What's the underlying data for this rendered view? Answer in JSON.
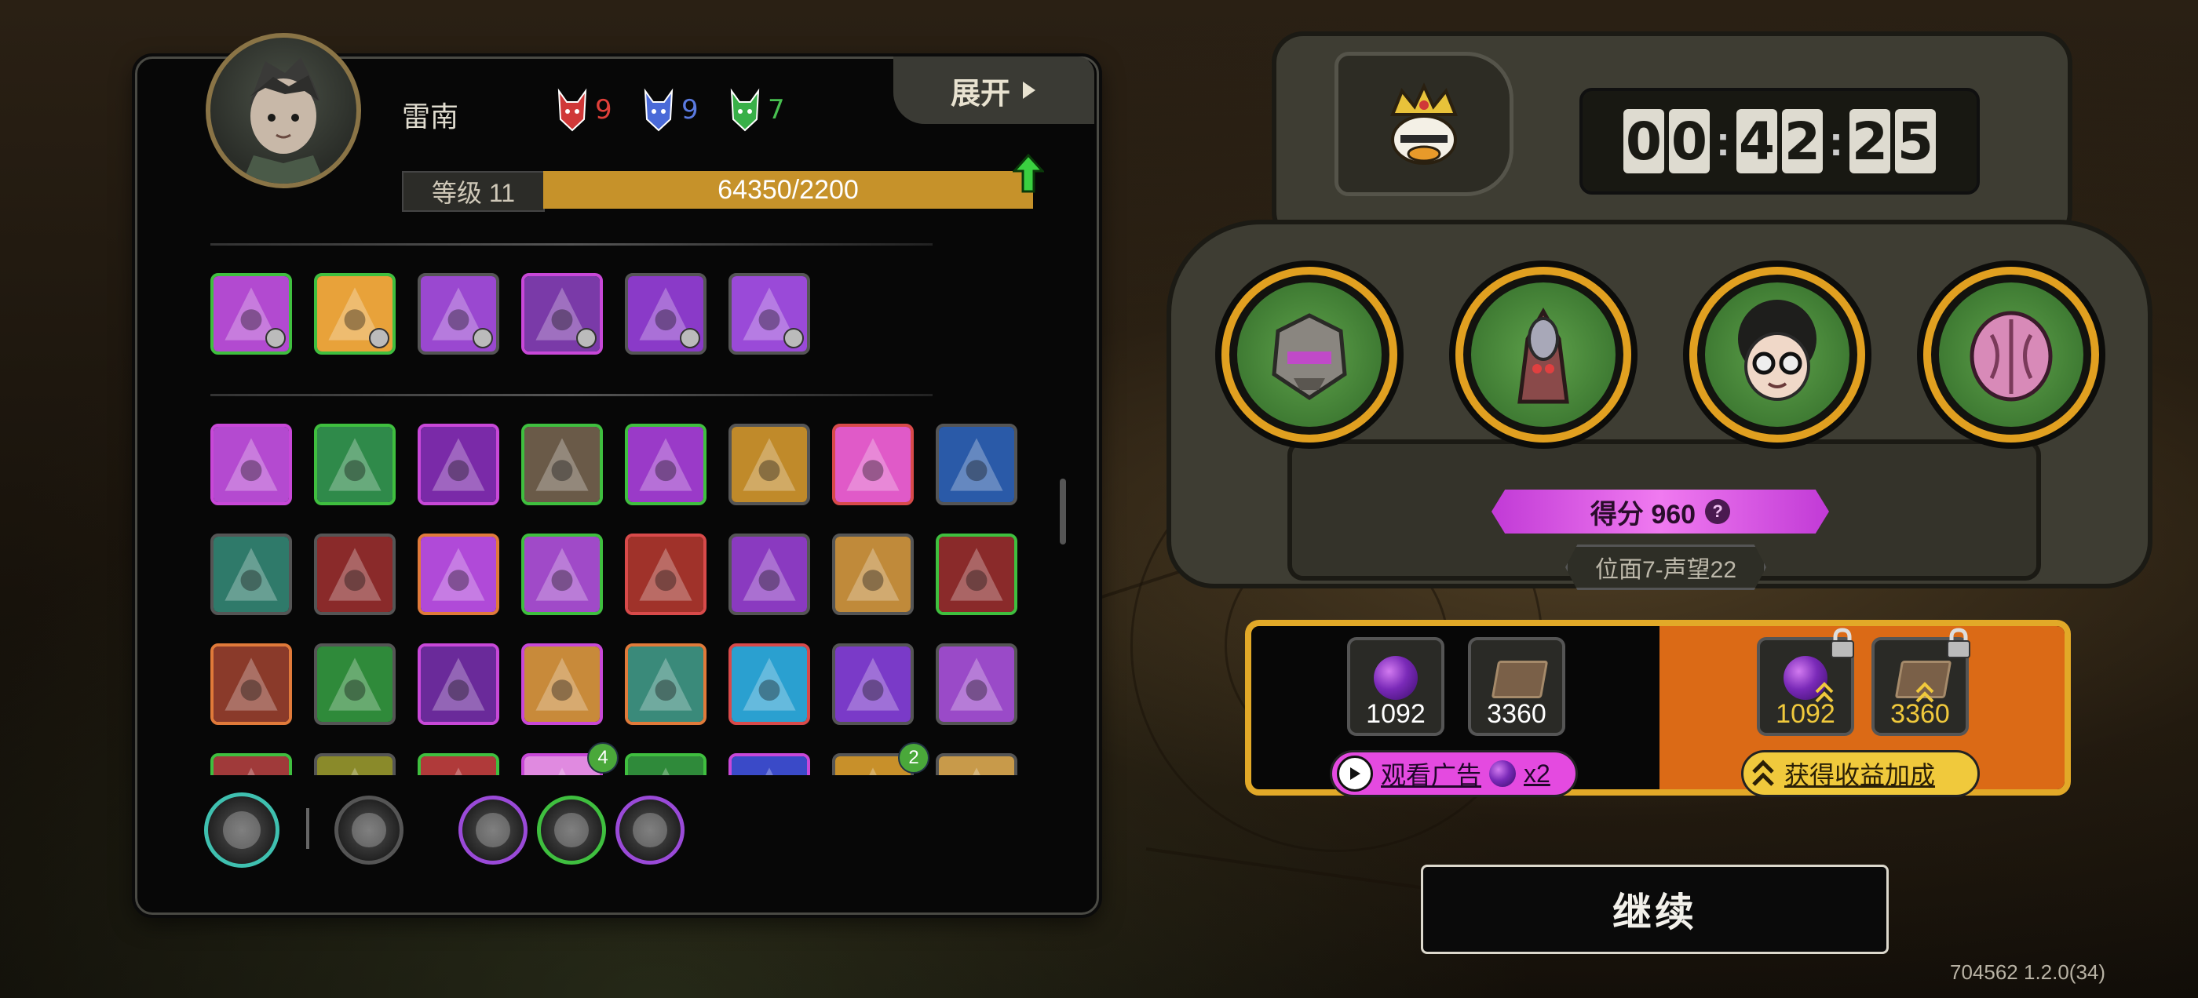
{
  "player": {
    "name": "雷南",
    "level_label": "等级 11",
    "xp_text": "64350/2200",
    "expand_label": "展开"
  },
  "costs": [
    {
      "icon": "red-horned-mask-icon",
      "value": "9",
      "color": "#e0403a"
    },
    {
      "icon": "blue-horned-mask-icon",
      "value": "9",
      "color": "#5a7ae0"
    },
    {
      "icon": "green-horned-mask-icon",
      "value": "7",
      "color": "#48c050"
    }
  ],
  "equip_slots": [
    {
      "name": "equip-slot-1",
      "icon": "pink-boot-icon",
      "frame": "#3fbf3f",
      "fill": "#b24ad0"
    },
    {
      "name": "equip-slot-2",
      "icon": "orange-belt-icon",
      "frame": "#3fbf3f",
      "fill": "#e8a23a"
    },
    {
      "name": "equip-slot-3",
      "icon": "purple-gauntlet-icon",
      "frame": "#555555",
      "fill": "#9a48d0"
    },
    {
      "name": "equip-slot-4",
      "icon": "crossed-blades-icon",
      "frame": "#c848d8",
      "fill": "#7a3aa8"
    },
    {
      "name": "equip-slot-5",
      "icon": "purple-cloak-icon",
      "frame": "#555555",
      "fill": "#8a3ac8"
    },
    {
      "name": "equip-slot-6",
      "icon": "purple-chestplate-icon",
      "frame": "#555555",
      "fill": "#9a4ad8"
    }
  ],
  "skill_rows": [
    [
      {
        "icon": "pink-warning-triangle-icon",
        "frame": "#c848d8",
        "fill": "#b44ad0"
      },
      {
        "icon": "green-diamond-icon",
        "frame": "#3fbf3f",
        "fill": "#2f8a4a"
      },
      {
        "icon": "purple-fang-icon",
        "frame": "#c848d8",
        "fill": "#7a2aa8"
      },
      {
        "icon": "spiral-vortex-icon",
        "frame": "#3fbf3f",
        "fill": "#6a5a48"
      },
      {
        "icon": "arrow-slash-icon",
        "frame": "#3fbf3f",
        "fill": "#9a3ac8"
      },
      {
        "icon": "golden-obelisk-icon",
        "frame": "#555555",
        "fill": "#c08a2a"
      },
      {
        "icon": "pink-burst-icon",
        "frame": "#d84a4a",
        "fill": "#e05ac8"
      },
      {
        "icon": "lightning-eye-icon",
        "frame": "#555555",
        "fill": "#2a5aa8"
      }
    ],
    [
      {
        "icon": "teal-wave-icon",
        "frame": "#555555",
        "fill": "#2f7a6a"
      },
      {
        "icon": "red-claw-marks-icon",
        "frame": "#555555",
        "fill": "#8a2a2a"
      },
      {
        "icon": "purple-eye-icon",
        "frame": "#e07a3a",
        "fill": "#b04ad8"
      },
      {
        "icon": "purple-web-icon",
        "frame": "#3fbf3f",
        "fill": "#a04ac8"
      },
      {
        "icon": "golden-slash-icon",
        "frame": "#d84a4a",
        "fill": "#a0322a"
      },
      {
        "icon": "purple-ghost-icon",
        "frame": "#555555",
        "fill": "#8a3ac0"
      },
      {
        "icon": "golden-crown-burst-icon",
        "frame": "#555555",
        "fill": "#c08a3a"
      },
      {
        "icon": "red-hand-icon",
        "frame": "#3fbf3f",
        "fill": "#8a2a2a"
      }
    ],
    [
      {
        "icon": "stone-wheel-icon",
        "frame": "#e07a3a",
        "fill": "#8a3a2a"
      },
      {
        "icon": "green-spikes-icon",
        "frame": "#555555",
        "fill": "#2f8a3a"
      },
      {
        "icon": "purple-demon-icon",
        "frame": "#c848d8",
        "fill": "#6a2a9a"
      },
      {
        "icon": "orange-vortex-icon",
        "frame": "#c848d8",
        "fill": "#c88a3a"
      },
      {
        "icon": "trap-cage-icon",
        "frame": "#e07a3a",
        "fill": "#3a8a7a"
      },
      {
        "icon": "blue-star-icon",
        "frame": "#d84a4a",
        "fill": "#2aa0d0"
      },
      {
        "icon": "purple-spiky-creature-icon",
        "frame": "#555555",
        "fill": "#7a3ac8"
      },
      {
        "icon": "purple-feather-icon",
        "frame": "#555555",
        "fill": "#9a4ac8"
      }
    ],
    [
      {
        "icon": "red-creature-icon",
        "frame": "#3fbf3f",
        "fill": "#a03a3a"
      },
      {
        "icon": "yellow-wings-icon",
        "frame": "#555555",
        "fill": "#8a8a2a"
      },
      {
        "icon": "red-flame-icon",
        "frame": "#3fbf3f",
        "fill": "#b03a3a"
      },
      {
        "icon": "pink-crystal-icon",
        "frame": "#c848d8",
        "fill": "#e08ae0",
        "badge": "4"
      },
      {
        "icon": "green-leaf-icon",
        "frame": "#3fbf3f",
        "fill": "#2f8a3a"
      },
      {
        "icon": "blue-spider-icon",
        "frame": "#c848d8",
        "fill": "#3a4ac8"
      },
      {
        "icon": "golden-shield-icon",
        "frame": "#555555",
        "fill": "#c8902a",
        "badge": "2"
      },
      {
        "icon": "golden-owl-icon",
        "frame": "#555555",
        "fill": "#c89a4a"
      }
    ]
  ],
  "bottom_icons": [
    {
      "name": "pink-potion-button",
      "icon": "pink-potion-icon",
      "ring": "#3fc0b0"
    },
    {
      "name": "red-talisman-button",
      "icon": "red-talisman-icon",
      "ring": "#555555"
    },
    {
      "name": "green-check-relic-button",
      "icon": "green-check-relic-icon",
      "ring": "#9a4ad8"
    },
    {
      "name": "grey-triangle-relic-button",
      "icon": "grey-triangle-relic-icon",
      "ring": "#3fbf3f"
    },
    {
      "name": "golden-bird-relic-button",
      "icon": "golden-bird-relic-icon",
      "ring": "#9a4ad8"
    }
  ],
  "timer": {
    "digits": [
      "0",
      "0",
      "4",
      "2",
      "2",
      "5"
    ]
  },
  "team": [
    {
      "name": "team-member-1",
      "icon": "armored-robot-head-icon"
    },
    {
      "name": "team-member-2",
      "icon": "hooded-alien-icon"
    },
    {
      "name": "team-member-3",
      "icon": "afro-glasses-face-icon"
    },
    {
      "name": "team-member-4",
      "icon": "pink-brain-creature-icon"
    }
  ],
  "score_label": "得分 960",
  "plane_label": "位面7-声望22",
  "rewards": {
    "base": [
      {
        "icon": "purple-orb-icon",
        "count": "1092"
      },
      {
        "icon": "book-icon",
        "count": "3360"
      }
    ],
    "bonus": [
      {
        "icon": "purple-orb-boost-icon",
        "count": "1092"
      },
      {
        "icon": "book-boost-icon",
        "count": "3360"
      }
    ],
    "watch_ad_label": "观看广告",
    "watch_ad_mult": "x2",
    "bonus_label": "获得收益加成"
  },
  "continue_label": "继续",
  "version": "704562 1.2.0(34)",
  "colors": {
    "gold": "#e2a928",
    "orange": "#db6a16",
    "magenta": "#e44ae0",
    "xp": "#c6922a"
  }
}
